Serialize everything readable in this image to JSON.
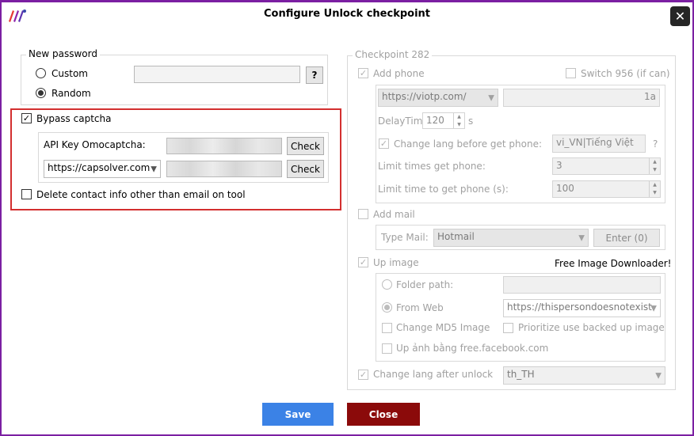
{
  "window": {
    "title": "Configure Unlock checkpoint",
    "close_glyph": "✕"
  },
  "password": {
    "legend": "New password",
    "custom_label": "Custom",
    "random_label": "Random",
    "custom_value": "",
    "help_label": "?",
    "selected": "random"
  },
  "captcha": {
    "bypass_label": "Bypass captcha",
    "bypass_checked": true,
    "api_key_label": "API Key Omocaptcha:",
    "check_label": "Check",
    "service_selected": "https://capsolver.com",
    "delete_contact_label": "Delete contact info other than email on tool",
    "delete_contact_checked": false
  },
  "checkpoint": {
    "legend": "Checkpoint 282",
    "add_phone_label": "Add phone",
    "add_phone_checked": true,
    "switch_label": "Switch 956 (if can)",
    "switch_checked": false,
    "phone_service": "https://viotp.com/",
    "phone_key_suffix": "1a",
    "delay_label": "DelayTime",
    "delay_value": "120",
    "delay_unit": "s",
    "change_lang_label": "Change lang before get phone:",
    "change_lang_checked": true,
    "lang_value": "vi_VN|Tiếng Việt",
    "lang_help": "?",
    "limit_times_label": "Limit times get phone:",
    "limit_times_value": "3",
    "limit_time_label": "Limit time to get phone (s):",
    "limit_time_value": "100",
    "add_mail_label": "Add mail",
    "add_mail_checked": false,
    "type_mail_label": "Type Mail:",
    "type_mail_value": "Hotmail",
    "enter_label": "Enter (0)",
    "up_image_label": "Up image",
    "up_image_checked": true,
    "free_image_label": "Free Image Downloader!",
    "folder_path_label": "Folder path:",
    "from_web_label": "From Web",
    "from_web_value": "https://thispersondoesnotexist.",
    "md5_label": "Change MD5 Image",
    "prioritize_label": "Prioritize use backed up image",
    "fb_label": "Up ảnh bằng free.facebook.com",
    "change_lang_after_label": "Change lang after unlock",
    "change_lang_after_checked": true,
    "lang_after_value": "th_TH"
  },
  "footer": {
    "save_label": "Save",
    "close_label": "Close"
  },
  "colors": {
    "accent_border": "#7b1fa2",
    "highlight_red": "#d32f2f",
    "save_blue": "#3b82e6",
    "close_red": "#8b0a0a"
  },
  "icons": {
    "logo": "app-logo-icon",
    "close": "close-icon",
    "chevron": "chevron-down-icon",
    "check": "✓",
    "spin_up": "▲",
    "spin_down": "▼"
  }
}
